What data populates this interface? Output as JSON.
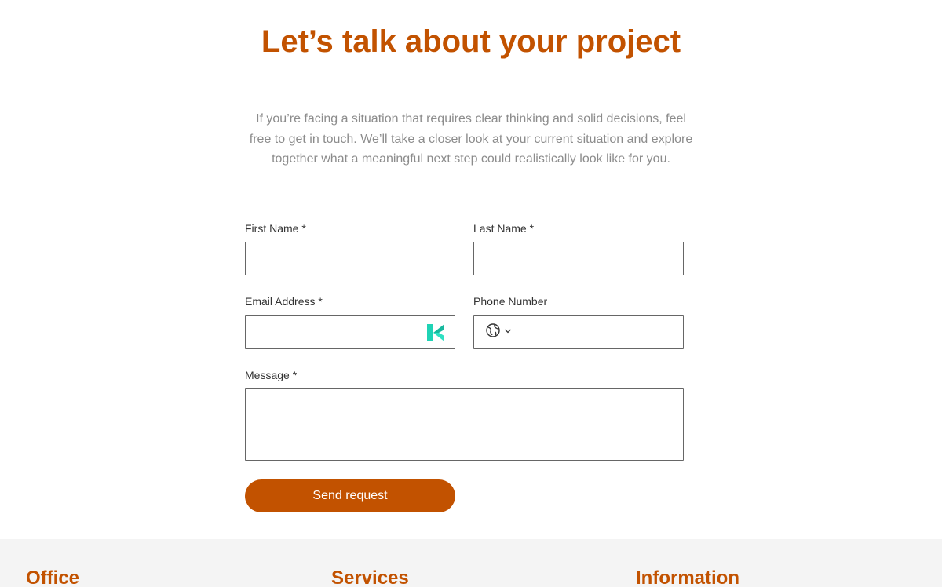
{
  "contact": {
    "headline": "Let’s talk about your project",
    "intro": "If you’re facing a situation that requires clear thinking and solid decisions, feel free to get in touch. We’ll take a closer look at your current situation and explore together what a meaningful next step could realistically look like for you.",
    "accent_color": "#c25200",
    "fields": {
      "first_name_label": "First Name *",
      "first_name_value": "",
      "last_name_label": "Last Name *",
      "last_name_value": "",
      "email_label": "Email Address *",
      "email_value": "",
      "phone_label": "Phone Number",
      "phone_value": "",
      "message_label": "Message *",
      "message_value": ""
    },
    "icons": {
      "email_addon": "k-extension-icon",
      "country_picker": "globe-icon",
      "country_caret": "chevron-down-icon"
    },
    "submit_label": "Send request"
  },
  "footer": {
    "background": "#f4f4f4",
    "office_heading": "Office",
    "services_heading": "Services",
    "information_heading": "Information"
  }
}
